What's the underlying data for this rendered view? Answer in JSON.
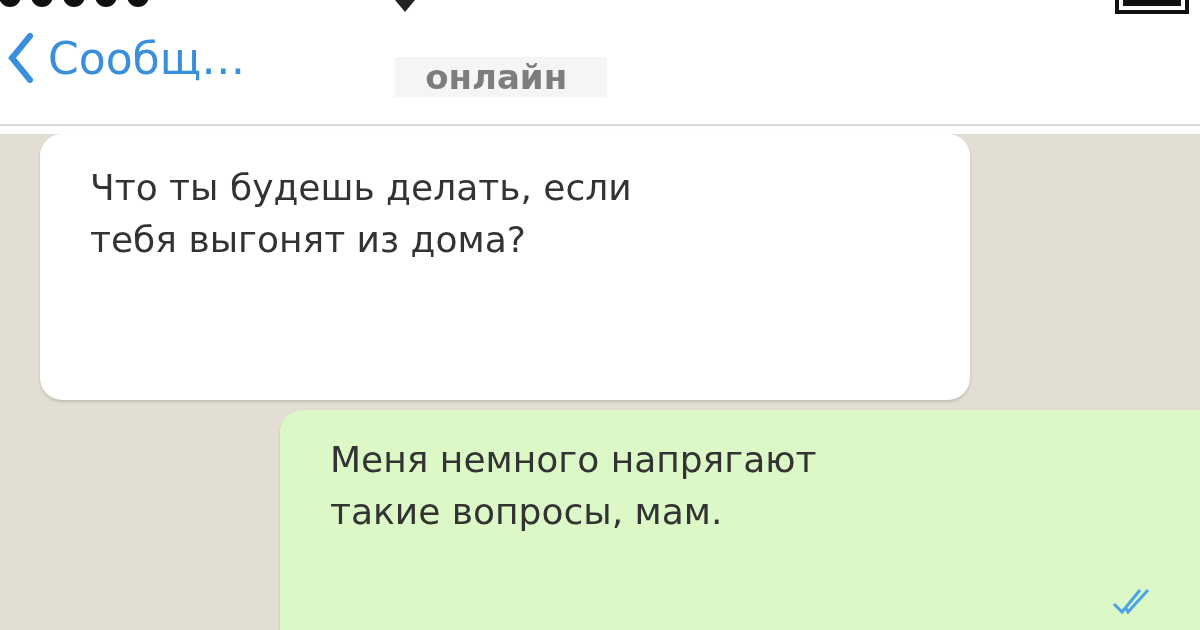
{
  "header": {
    "back_label": "Сообщ…",
    "status": "онлайн"
  },
  "messages": [
    {
      "kind": "incoming",
      "text": "Что ты будешь делать, если\nтебя выгонят из дома?"
    },
    {
      "kind": "outgoing",
      "text": "Меня немного напрягают\nтакие вопросы, мам.",
      "read": true
    }
  ]
}
